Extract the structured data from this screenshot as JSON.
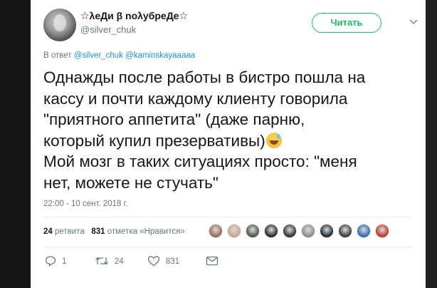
{
  "profile": {
    "display_name": "☆λeДи β noλyбpeДe☆",
    "handle": "@silver_chuk"
  },
  "follow_button": {
    "label": "Читать",
    "color": "#17bf63"
  },
  "reply": {
    "prefix": "В ответ",
    "mentions": [
      "@silver_chuk",
      "@kaminskayaaaaa"
    ]
  },
  "tweet": {
    "lines": [
      "Однажды после работы в бистро пошла на",
      "кассу и почти каждому клиенту говорила",
      "\"приятного аппетита\" (даже парню,",
      "который купил презервативы)",
      "Мой мозг в таких ситуациях просто: \"меня",
      "нет, можете не стучать\""
    ],
    "emoji": "grinning-face-with-sweat"
  },
  "timestamp": "22:00 - 10 сент. 2018 г.",
  "stats": {
    "retweets_count": "24",
    "retweets_label": "ретвита",
    "likes_count": "831",
    "likes_label": "отметка «Нравится»"
  },
  "likers": [
    {
      "name": "liker-avatar-1",
      "color": "#9b6a5a"
    },
    {
      "name": "liker-avatar-2",
      "color": "#c9a48e"
    },
    {
      "name": "liker-avatar-3",
      "color": "#4d5a4a"
    },
    {
      "name": "liker-avatar-4",
      "color": "#2a2a2a"
    },
    {
      "name": "liker-avatar-5",
      "color": "#3b2f3a"
    },
    {
      "name": "liker-avatar-6",
      "color": "#8c8c8c"
    },
    {
      "name": "liker-avatar-7",
      "color": "#1f2a3a"
    },
    {
      "name": "liker-avatar-8",
      "color": "#3c3c3c"
    },
    {
      "name": "liker-avatar-9",
      "color": "#2f6fb0"
    },
    {
      "name": "liker-avatar-10",
      "color": "#c0392b"
    }
  ],
  "actions": {
    "reply_count": "1",
    "retweet_count": "24",
    "like_count": "831"
  },
  "icons": [
    "caret-down-icon",
    "reply-icon",
    "retweet-icon",
    "like-icon",
    "message-icon"
  ]
}
